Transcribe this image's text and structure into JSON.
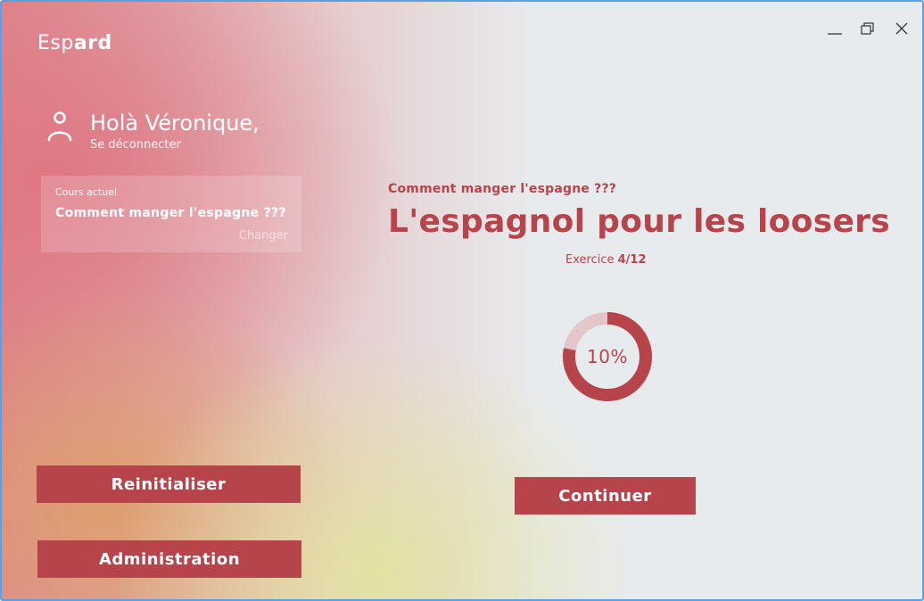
{
  "app": {
    "logo_light": "Esp",
    "logo_bold": "ard"
  },
  "window_controls": {
    "minimize_icon": "minimize-icon",
    "restore_icon": "restore-icon",
    "close_icon": "close-icon"
  },
  "user": {
    "greeting": "Holà Véronique,",
    "logout_label": "Se déconnecter"
  },
  "current_course": {
    "label": "Cours actuel",
    "title": "Comment manger l'espagne ???",
    "change_label": "Changer"
  },
  "sidebar": {
    "reset_label": "Reinitialiser",
    "admin_label": "Administration"
  },
  "main": {
    "course_subtitle": "Comment manger l'espagne ???",
    "lesson_title": "L'espagnol pour les loosers",
    "exercise_prefix": "Exercice ",
    "exercise_value": "4/12",
    "progress_percent": 10,
    "progress_text": "10%",
    "continue_label": "Continuer"
  },
  "colors": {
    "accent": "#b8444b",
    "track": "#e2c6ca",
    "panel": "#e8ebee"
  }
}
